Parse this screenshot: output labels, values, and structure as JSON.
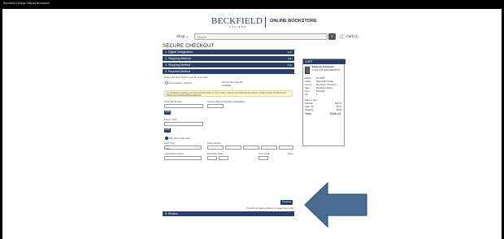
{
  "window": {
    "title": "Beckfield College Official Bookstore"
  },
  "header": {
    "brand": "BECKFIELD",
    "brand_sub": "COLLEGE",
    "store": "ONLINE BOOKSTORE",
    "shop_label": "Shop",
    "search_placeholder": "Search",
    "cart_label": "Cart (1)"
  },
  "checkout": {
    "title": "SECURE CHECKOUT",
    "steps": [
      {
        "label": "1. Digital Designation",
        "edit": "Edit"
      },
      {
        "label": "2. Shipping Address",
        "edit": "Edit"
      },
      {
        "label": "3. Shipping Method",
        "edit": "Edit"
      },
      {
        "label": "4. Payment Method"
      },
      {
        "label": "5. Review"
      }
    ],
    "payment_intro": "Select and enter fields to pay for your order",
    "financial_aid_label": "Financial Aid / Voucher",
    "available_funds_label": "Student Aid & Funds",
    "available_funds_value": "Available",
    "notice": "For questions regarding your financial aid funds or if your order exceeds your financial aid amount, please contact the Bookstore: Phone and bookstore@beckfield.edu",
    "gift_card_label": "Gift Card Number",
    "security_pin_label": "Security PIN (if included / applicable)",
    "apply_label": "Apply",
    "promo_label": "Promo Code",
    "apply2_label": "Apply",
    "credit_card_label": "Pay with Credit Card",
    "card_type_label": "Card Type",
    "card_type_value": "Visa",
    "card_number_label": "Card Number",
    "cardholder_label": "Cardholder's Name",
    "exp_label": "Expiration Date",
    "exp_value": "---",
    "cvv_label": "CVV Code",
    "save_label": "Save",
    "continue_label": "Continue",
    "continue_note": "You will not have a chance to review your order"
  },
  "cart": {
    "title": "CART",
    "item_label": "Book",
    "item_title": "Electronic Commerce",
    "item_sub": "Turban 2nd (9780135189733)",
    "details": [
      {
        "k": "Edition",
        "v": "5th 2018"
      },
      {
        "k": "Author",
        "v": "Mark Duffy/Turban"
      },
      {
        "k": "Course",
        "v": "Electronic Commerce"
      },
      {
        "k": "Dept",
        "v": "Beckfield (Online)"
      },
      {
        "k": "Term",
        "v": "Fall 2021"
      },
      {
        "k": "Qty",
        "v": "1"
      }
    ],
    "items_count": "Items in Cart",
    "subtotal_label": "Subtotal",
    "subtotal_value": "$99.70",
    "tax_label": "Sales Tax",
    "tax_value": "$6.74",
    "shipping_label": "Shipping",
    "shipping_value": "$0.00",
    "total_label": "Total",
    "total_value": "$106.44"
  },
  "colors": {
    "navy": "#27406b",
    "arrow_fill": "#4a6b94",
    "arrow_stroke": "#3a5575"
  },
  "icons": {
    "search": "search-icon",
    "cart": "cart-icon",
    "chevron": "chevron-down-icon"
  }
}
